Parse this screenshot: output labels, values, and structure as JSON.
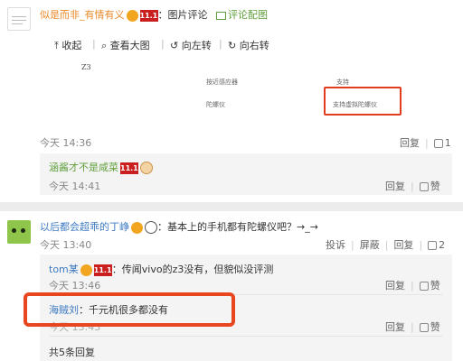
{
  "comment1": {
    "author": "似是而非_有情有义",
    "suffix": "：图片评论",
    "view_pic": "评论配图",
    "viewer": {
      "collapse": "收起",
      "view_large": "查看大图",
      "rotate_left": "向左转",
      "rotate_right": "向右转",
      "model": "Z3",
      "row1_left": "按近感应器",
      "row1_right": "支持",
      "row2_left": "陀螺仪",
      "row2_right": "支持虚拟陀螺仪"
    },
    "time": "今天 14:36",
    "reply_label": "回复",
    "like_count": "1",
    "sub_reply": {
      "author": "涵酱才不是咸菜",
      "time": "今天 14:41",
      "reply_label": "回复",
      "like_label": "赞"
    }
  },
  "comment2": {
    "author": "以后都会超乖的丁峥",
    "text": "：基本上的手机都有陀螺仪吧？→_→",
    "time": "今天 13:40",
    "report": "投诉",
    "block": "屏蔽",
    "reply_label": "回复",
    "like_count": "2",
    "replies": [
      {
        "author": "tom某",
        "text": "：传闻vivo的z3没有，但貌似没评测",
        "time": "今天 13:46",
        "reply_label": "回复",
        "like_label": "赞"
      },
      {
        "author": "海贼刘",
        "text": "：千元机很多都没有",
        "time": "今天 13:43",
        "reply_label": "回复",
        "like_label": "赞"
      }
    ],
    "more": "共5条回复"
  },
  "colors": {
    "author": "#ea8a2b",
    "link": "#3d7ac1",
    "highlight": "#e8461f"
  }
}
